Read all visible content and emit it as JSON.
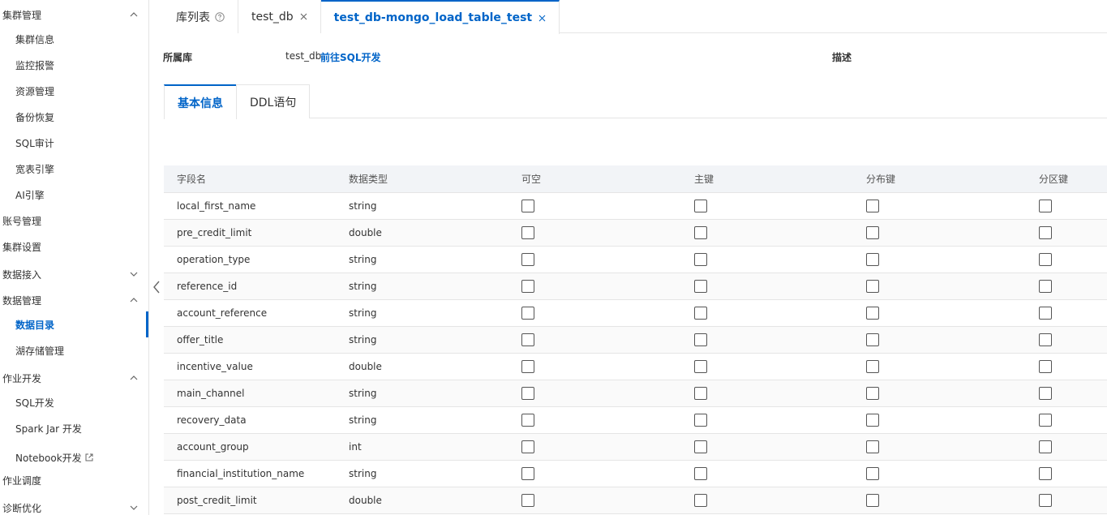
{
  "sidebar": {
    "groups": [
      {
        "label": "集群管理",
        "expanded": true
      },
      {
        "label": "账号管理"
      },
      {
        "label": "集群设置"
      },
      {
        "label": "数据接入",
        "expanded": false
      },
      {
        "label": "数据管理",
        "expanded": true
      },
      {
        "label": "作业开发",
        "expanded": true
      },
      {
        "label": "作业调度"
      },
      {
        "label": "诊断优化",
        "expanded": false
      }
    ],
    "cluster_items": [
      "集群信息",
      "监控报警",
      "资源管理",
      "备份恢复",
      "SQL审计",
      "宽表引擎",
      "AI引擎"
    ],
    "data_items": [
      "数据目录",
      "湖存储管理"
    ],
    "dev_items": [
      "SQL开发",
      "Spark Jar 开发",
      "Notebook开发"
    ],
    "active_item": "数据目录",
    "accent_color": "#0064c8"
  },
  "tabs": [
    {
      "label": "库列表",
      "icon": "help-icon"
    },
    {
      "label": "test_db",
      "icon": "close-icon"
    },
    {
      "label": "test_db-mongo_load_table_test",
      "icon": "close-icon",
      "active": true
    }
  ],
  "info": {
    "db_label": "所属库",
    "db_value": "test_db",
    "db_link": "前往SQL开发",
    "desc_label": "描述"
  },
  "subtabs": [
    {
      "label": "基本信息",
      "active": true
    },
    {
      "label": "DDL语句"
    }
  ],
  "table": {
    "headers": [
      "字段名",
      "数据类型",
      "可空",
      "主键",
      "分布键",
      "分区键"
    ],
    "rows": [
      {
        "name": "local_first_name",
        "type": "string"
      },
      {
        "name": "pre_credit_limit",
        "type": "double"
      },
      {
        "name": "operation_type",
        "type": "string"
      },
      {
        "name": "reference_id",
        "type": "string"
      },
      {
        "name": "account_reference",
        "type": "string"
      },
      {
        "name": "offer_title",
        "type": "string"
      },
      {
        "name": "incentive_value",
        "type": "double"
      },
      {
        "name": "main_channel",
        "type": "string"
      },
      {
        "name": "recovery_data",
        "type": "string"
      },
      {
        "name": "account_group",
        "type": "int"
      },
      {
        "name": "financial_institution_name",
        "type": "string"
      },
      {
        "name": "post_credit_limit",
        "type": "double"
      }
    ]
  }
}
